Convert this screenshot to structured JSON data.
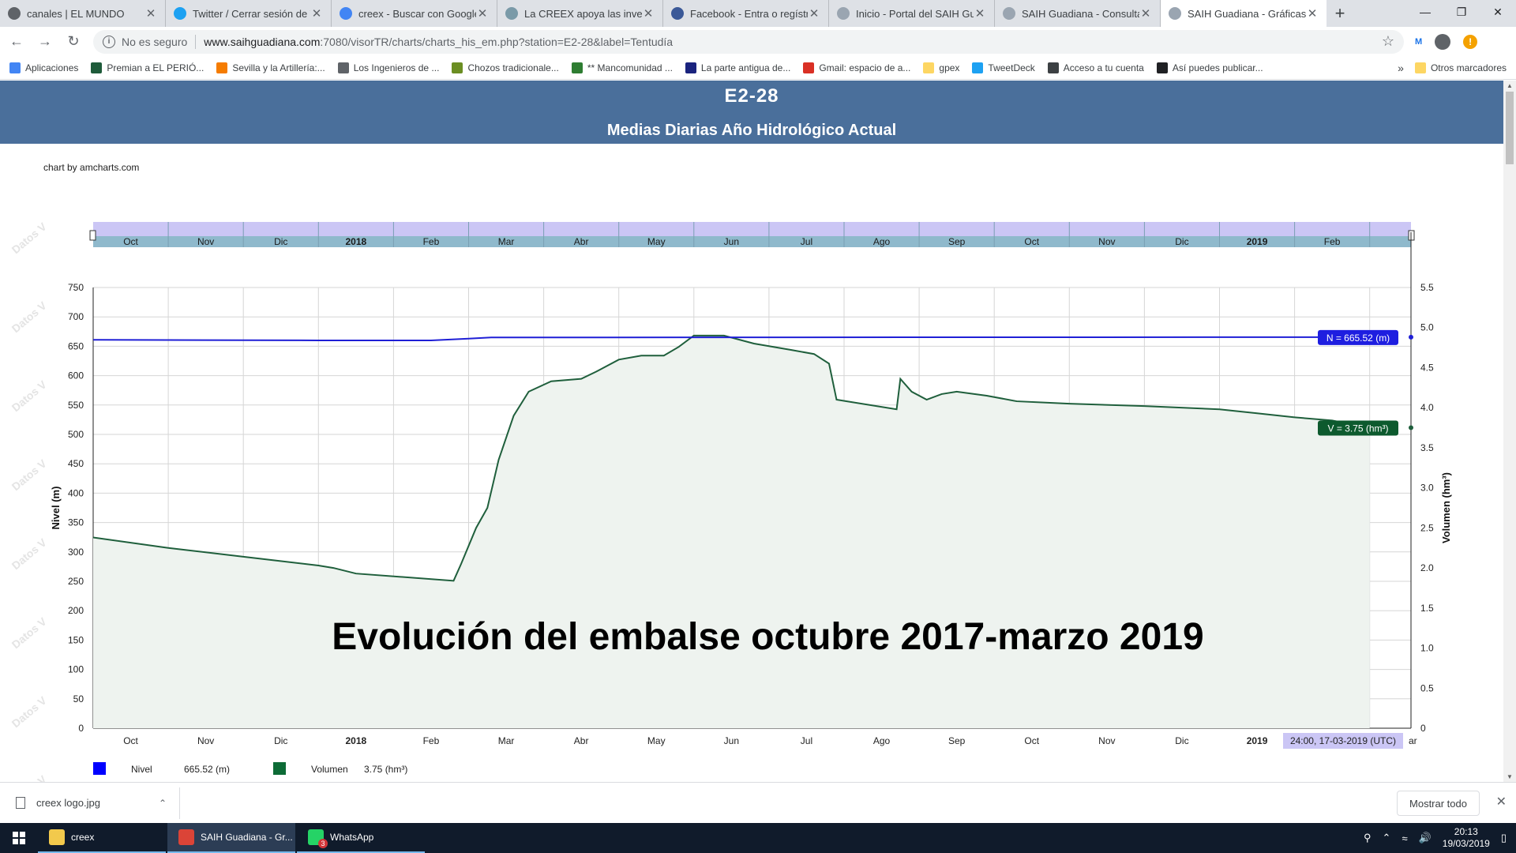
{
  "browser": {
    "tabs": [
      {
        "title": "canales | EL MUNDO",
        "color": "#5f6368"
      },
      {
        "title": "Twitter / Cerrar sesión de Tw",
        "color": "#1da1f2"
      },
      {
        "title": "creex - Buscar con Google",
        "color": "#4285f4"
      },
      {
        "title": "La CREEX apoya las inversio",
        "color": "#7a9aa8"
      },
      {
        "title": "Facebook - Entra o regístrat",
        "color": "#3b5998"
      },
      {
        "title": "Inicio - Portal del SAIH Gua",
        "color": "#9aa5b1"
      },
      {
        "title": "SAIH Guadiana - Consulta d",
        "color": "#9aa5b1"
      },
      {
        "title": "SAIH Guadiana - Gráficas hi",
        "color": "#9aa5b1"
      }
    ],
    "security_label": "No es seguro",
    "url_host": "www.saihguadiana.com",
    "url_path": ":7080/visorTR/charts/charts_his_em.php?station=E2-28&label=Tentudía",
    "bookmarks": [
      {
        "label": "Aplicaciones",
        "color": "#4285f4"
      },
      {
        "label": "Premian a EL PERIÓ...",
        "color": "#1e5b3a"
      },
      {
        "label": "Sevilla y la Artillería:...",
        "color": "#f57c00"
      },
      {
        "label": "Los Ingenieros de ...",
        "color": "#5f6368"
      },
      {
        "label": "Chozos tradicionale...",
        "color": "#6b8e23"
      },
      {
        "label": "** Mancomunidad ...",
        "color": "#2e7d32"
      },
      {
        "label": "La parte antigua de...",
        "color": "#1a237e"
      },
      {
        "label": "Gmail: espacio de a...",
        "color": "#d93025"
      },
      {
        "label": "gpex",
        "color": "#fdd663"
      },
      {
        "label": "TweetDeck",
        "color": "#1da1f2"
      },
      {
        "label": "Acceso a tu cuenta",
        "color": "#3c4043"
      },
      {
        "label": "Así puedes publicar...",
        "color": "#202124"
      }
    ],
    "bookmarks_more": "»",
    "other_bookmarks": "Otros marcadores"
  },
  "page": {
    "station": "E2-28",
    "subtitle": "Medias Diarias Año Hidrológico Actual",
    "credit": "chart by amcharts.com",
    "watermark": "Datos V",
    "overlay_text": "Evolución del embalse octubre 2017-marzo 2019"
  },
  "chart_data": {
    "type": "line",
    "x_categories": [
      "Oct",
      "Nov",
      "Dic",
      "2018",
      "Feb",
      "Mar",
      "Abr",
      "May",
      "Jun",
      "Jul",
      "Ago",
      "Sep",
      "Oct",
      "Nov",
      "Dic",
      "2019",
      "Feb"
    ],
    "last_partial_label": "ar",
    "ylabel_left": "Nivel (m)",
    "ylabel_right": "Volumen (hm³)",
    "ylim_left": [
      0,
      750
    ],
    "ylim_right": [
      0,
      5.5
    ],
    "yticks_left": [
      0,
      50,
      100,
      150,
      200,
      250,
      300,
      350,
      400,
      450,
      500,
      550,
      600,
      650,
      700,
      750
    ],
    "yticks_right": [
      0,
      0.5,
      1.0,
      1.5,
      2.0,
      2.5,
      3.0,
      3.5,
      4.0,
      4.5,
      5.0,
      5.5
    ],
    "grid": true,
    "series": [
      {
        "name": "Nivel",
        "axis": "left",
        "color": "#1f1fd6",
        "points": [
          [
            0,
            661
          ],
          [
            3,
            660
          ],
          [
            4.5,
            660
          ],
          [
            5,
            663
          ],
          [
            5.3,
            665
          ],
          [
            17,
            665.52
          ]
        ]
      },
      {
        "name": "Volumen",
        "axis": "right",
        "color": "#1f5f3c",
        "fill": "#eef3ef",
        "points": [
          [
            0,
            2.38
          ],
          [
            1,
            2.25
          ],
          [
            2,
            2.14
          ],
          [
            3,
            2.03
          ],
          [
            3.2,
            2.0
          ],
          [
            3.5,
            1.93
          ],
          [
            4.8,
            1.84
          ],
          [
            4.9,
            2.05
          ],
          [
            5.1,
            2.5
          ],
          [
            5.25,
            2.75
          ],
          [
            5.4,
            3.35
          ],
          [
            5.6,
            3.9
          ],
          [
            5.8,
            4.2
          ],
          [
            6.1,
            4.33
          ],
          [
            6.5,
            4.36
          ],
          [
            6.7,
            4.45
          ],
          [
            7.0,
            4.6
          ],
          [
            7.3,
            4.65
          ],
          [
            7.6,
            4.65
          ],
          [
            7.8,
            4.76
          ],
          [
            8.0,
            4.9
          ],
          [
            8.4,
            4.9
          ],
          [
            8.8,
            4.8
          ],
          [
            9.3,
            4.72
          ],
          [
            9.6,
            4.67
          ],
          [
            9.8,
            4.55
          ],
          [
            9.9,
            4.1
          ],
          [
            10.7,
            3.98
          ],
          [
            10.75,
            4.36
          ],
          [
            10.9,
            4.2
          ],
          [
            11.1,
            4.1
          ],
          [
            11.3,
            4.17
          ],
          [
            11.5,
            4.2
          ],
          [
            11.9,
            4.15
          ],
          [
            12.3,
            4.08
          ],
          [
            13,
            4.05
          ],
          [
            14,
            4.02
          ],
          [
            15,
            3.98
          ],
          [
            15.5,
            3.93
          ],
          [
            16,
            3.88
          ],
          [
            16.5,
            3.84
          ],
          [
            17,
            3.75
          ]
        ]
      }
    ],
    "labels": {
      "nivel_flag": "N = 665.52 (m)",
      "volumen_flag": "V = 3.75 (hm³)",
      "cursor_date": "24:00, 17-03-2019 (UTC)"
    },
    "legend": [
      {
        "name": "Nivel",
        "value": "665.52 (m)",
        "color": "#0000ff"
      },
      {
        "name": "Volumen",
        "value": "3.75 (hm³)",
        "color": "#0d6b36"
      }
    ]
  },
  "download": {
    "file": "creex logo.jpg",
    "show_all": "Mostrar todo"
  },
  "taskbar": {
    "apps": [
      {
        "label": "creex",
        "color": "#f2c94c",
        "badge": ""
      },
      {
        "label": "SAIH Guadiana - Gr...",
        "color": "#db4437",
        "badge": ""
      },
      {
        "label": "WhatsApp",
        "color": "#25d366",
        "badge": "3"
      }
    ],
    "time": "20:13",
    "date": "19/03/2019"
  }
}
